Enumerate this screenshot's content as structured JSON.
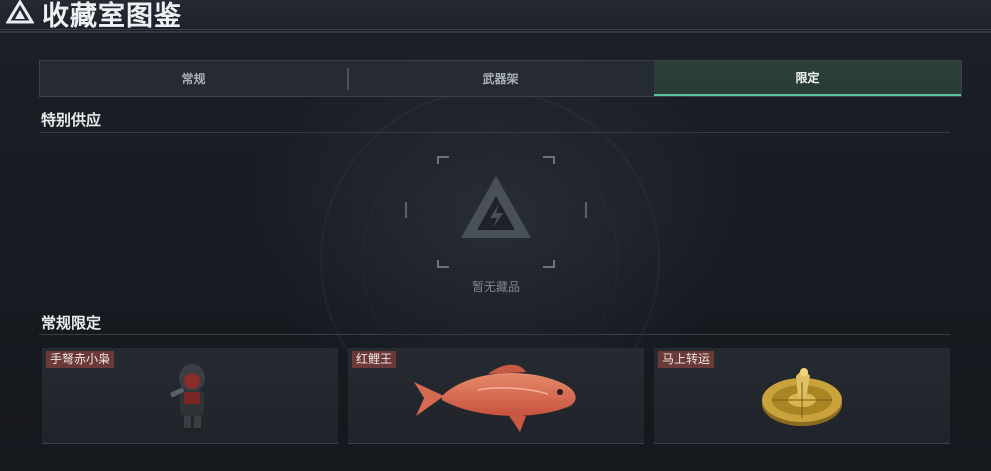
{
  "header": {
    "title": "收藏室图鉴",
    "logo_icon": "triangle-logo-icon"
  },
  "tabs": [
    {
      "label": "常规",
      "active": false
    },
    {
      "label": "武器架",
      "active": false
    },
    {
      "label": "限定",
      "active": true
    }
  ],
  "special_supply": {
    "title": "特别供应",
    "empty_text": "暂无藏品",
    "empty_icon": "triangle-bolt-logo-icon"
  },
  "regular_limited": {
    "title": "常规限定",
    "items": [
      {
        "label": "手弩赤小枭",
        "icon": "hooded-figurine-icon"
      },
      {
        "label": "红鲤王",
        "icon": "red-carp-icon"
      },
      {
        "label": "马上转运",
        "icon": "golden-horse-wheel-icon"
      }
    ]
  },
  "colors": {
    "accent": "#5bc39a",
    "label_bg": "#6b3a38",
    "background": "#16191f"
  }
}
